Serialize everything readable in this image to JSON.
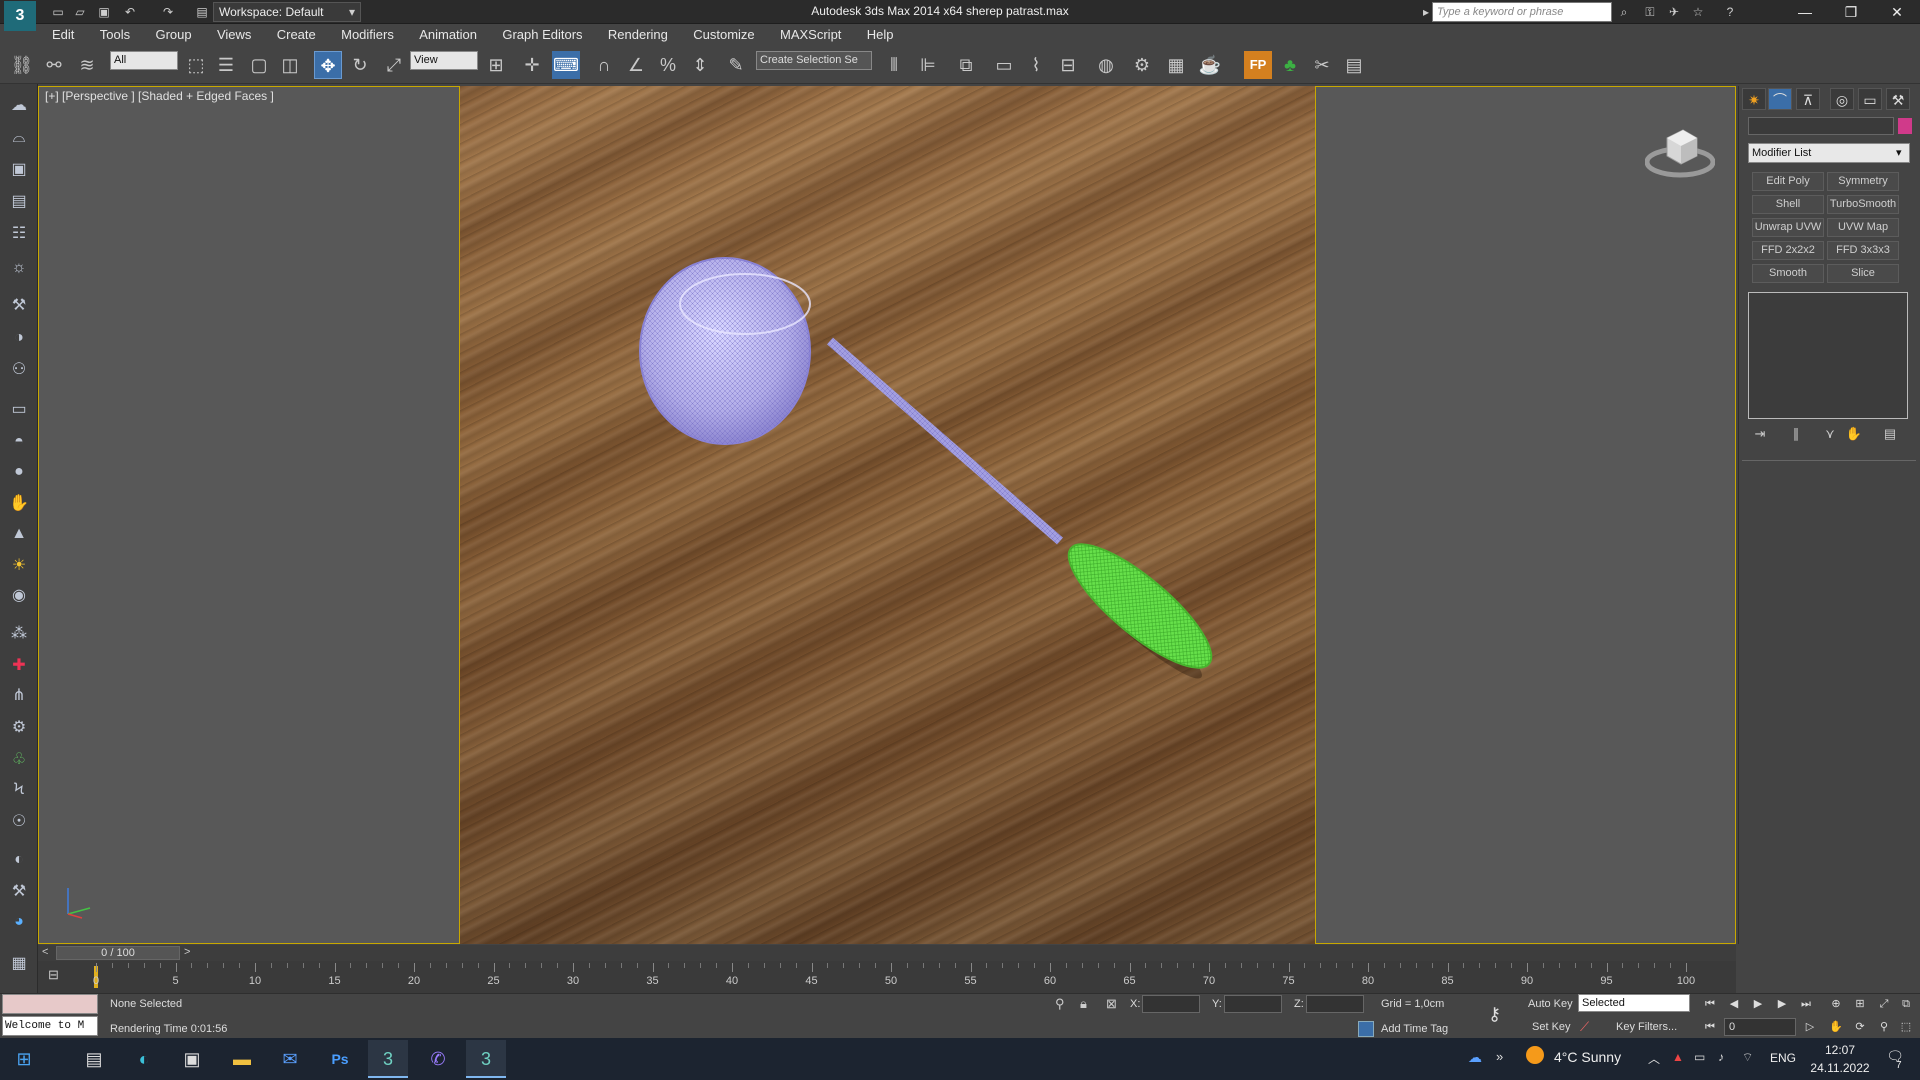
{
  "window": {
    "title": "Autodesk 3ds Max  2014 x64      sherep  patrast.max",
    "workspace": "Workspace: Default",
    "search_placeholder": "Type a keyword or phrase",
    "minimize": "—",
    "maximize": "❐",
    "close": "✕"
  },
  "menu": [
    "Edit",
    "Tools",
    "Group",
    "Views",
    "Create",
    "Modifiers",
    "Animation",
    "Graph Editors",
    "Rendering",
    "Customize",
    "MAXScript",
    "Help"
  ],
  "toolbar": {
    "selection_filter": "All",
    "reference_coord": "View",
    "named_selection": "Create Selection Se",
    "fp_label": "FP"
  },
  "viewport": {
    "label": "[+] [Perspective ] [Shaded + Edged Faces ]",
    "accent_color": "#c8a800",
    "handle_color": "#66e04a",
    "strainer_color": "#b8b4f0"
  },
  "command_panel": {
    "modifier_list": "Modifier List",
    "modifier_buttons": [
      "Edit Poly",
      "Symmetry",
      "Shell",
      "TurboSmooth",
      "Unwrap UVW",
      "UVW Map",
      "FFD 2x2x2",
      "FFD 3x3x3",
      "Smooth",
      "Slice"
    ],
    "object_color": "#d03a8a"
  },
  "timeline": {
    "frame_indicator": "0 / 100",
    "ticks": [
      "0",
      "5",
      "10",
      "15",
      "20",
      "25",
      "30",
      "35",
      "40",
      "45",
      "50",
      "55",
      "60",
      "65",
      "70",
      "75",
      "80",
      "85",
      "90",
      "95",
      "100"
    ]
  },
  "status": {
    "maxscript_welcome": "Welcome to M",
    "selection_status": "None Selected",
    "prompt": "Rendering Time  0:01:56",
    "x_label": "X:",
    "y_label": "Y:",
    "z_label": "Z:",
    "grid": "Grid = 1,0cm",
    "add_time_tag": "Add Time Tag",
    "auto_key": "Auto Key",
    "set_key": "Set Key",
    "key_filters": "Key Filters...",
    "selected_dropdown": "Selected",
    "current_frame": "0"
  },
  "taskbar": {
    "weather": "4°C  Sunny",
    "language": "ENG",
    "time": "12:07",
    "date": "24.11.2022",
    "notifications": "7"
  }
}
